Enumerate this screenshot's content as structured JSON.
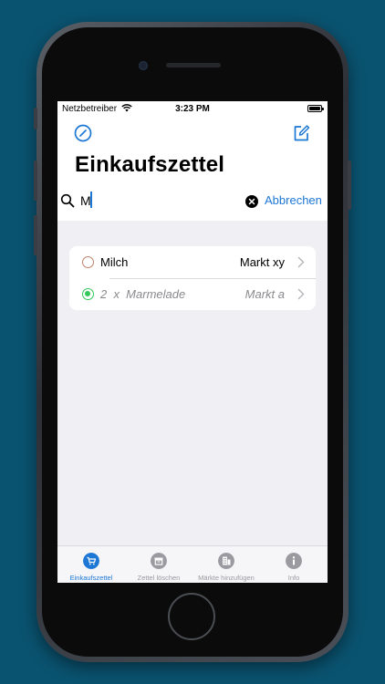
{
  "status_bar": {
    "carrier": "Netzbetreiber",
    "time": "3:23 PM"
  },
  "nav": {
    "title": "Einkaufszettel",
    "left_icon": "slash-circle-icon",
    "right_icon": "compose-icon"
  },
  "search": {
    "value": "M",
    "cancel_label": "Abbrechen"
  },
  "items": [
    {
      "name": "Milch",
      "store": "Markt xy",
      "checked": false
    },
    {
      "quantity_text": "2 x Marmelade",
      "name": "2  x  Marmelade",
      "store": "Markt a",
      "checked": true
    }
  ],
  "tabs": [
    {
      "label": "Einkaufszettel",
      "icon": "cart-icon",
      "active": true
    },
    {
      "label": "Zettel löschen",
      "icon": "trash-box-icon",
      "active": false
    },
    {
      "label": "Märkte hinzufügen",
      "icon": "building-icon",
      "active": false
    },
    {
      "label": "Info",
      "icon": "info-icon",
      "active": false
    }
  ],
  "colors": {
    "accent": "#1d77d5",
    "background": "#0a5370",
    "unchecked": "#c4806a",
    "checked": "#34c759"
  }
}
